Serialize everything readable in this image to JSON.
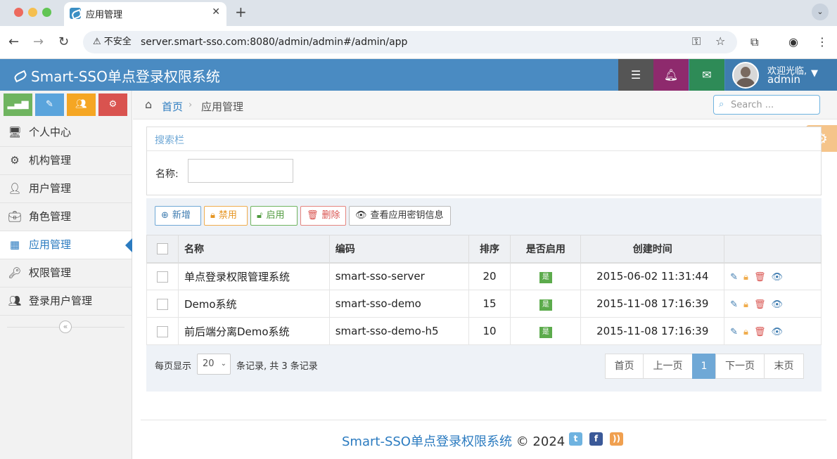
{
  "browser": {
    "tab_title": "应用管理",
    "security_label": "不安全",
    "url": "server.smart-sso.com:8080/admin/admin#/admin/app"
  },
  "header": {
    "app_title": "Smart-SSO单点登录权限系统",
    "welcome": "欢迎光临,",
    "username": "admin"
  },
  "sidebar": {
    "shortcuts": [
      {
        "icon": "stats-icon",
        "color": "#6fb45f"
      },
      {
        "icon": "pencil-icon",
        "color": "#5aa4dc"
      },
      {
        "icon": "users-icon",
        "color": "#f5a623"
      },
      {
        "icon": "cogs-icon",
        "color": "#d9534f"
      }
    ],
    "items": [
      {
        "label": "个人中心",
        "icon": "desktop-icon"
      },
      {
        "label": "机构管理",
        "icon": "cogs-icon"
      },
      {
        "label": "用户管理",
        "icon": "user-icon"
      },
      {
        "label": "角色管理",
        "icon": "briefcase-icon"
      },
      {
        "label": "应用管理",
        "icon": "grid-icon",
        "active": true
      },
      {
        "label": "权限管理",
        "icon": "key-icon"
      },
      {
        "label": "登录用户管理",
        "icon": "group-icon"
      }
    ]
  },
  "breadcrumb": {
    "home": "首页",
    "current": "应用管理"
  },
  "search": {
    "placeholder": "Search ..."
  },
  "filter": {
    "title": "搜索栏",
    "name_label": "名称:",
    "name_value": ""
  },
  "toolbar": {
    "add": "新增",
    "disable": "禁用",
    "enable": "启用",
    "delete": "删除",
    "view_secret": "查看应用密钥信息"
  },
  "table": {
    "columns": [
      "名称",
      "编码",
      "排序",
      "是否启用",
      "创建时间"
    ],
    "rows": [
      {
        "name": "单点登录权限管理系统",
        "code": "smart-sso-server",
        "sort": "20",
        "enabled": "是",
        "created": "2015-06-02 11:31:44"
      },
      {
        "name": "Demo系统",
        "code": "smart-sso-demo",
        "sort": "15",
        "enabled": "是",
        "created": "2015-11-08 17:16:39"
      },
      {
        "name": "前后端分离Demo系统",
        "code": "smart-sso-demo-h5",
        "sort": "10",
        "enabled": "是",
        "created": "2015-11-08 17:16:39"
      }
    ]
  },
  "pagination": {
    "per_page_label": "每页显示",
    "per_page": "20",
    "records_text": "条记录, 共 3 条记录",
    "first": "首页",
    "prev": "上一页",
    "current": "1",
    "next": "下一页",
    "last": "末页"
  },
  "footer": {
    "brand": "Smart-SSO单点登录权限系统",
    "copyright": "© 2024"
  }
}
